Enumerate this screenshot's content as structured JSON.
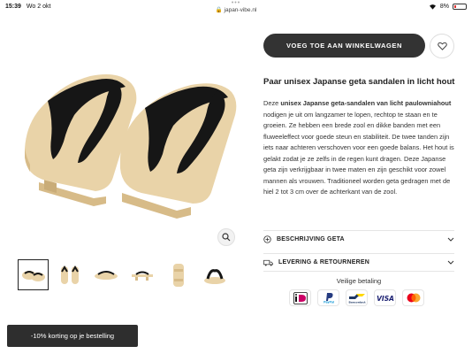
{
  "status_bar": {
    "time": "15:39",
    "date": "Wo 2 okt",
    "url": "japan-vibe.nl",
    "dots": "•••",
    "battery": "8%"
  },
  "product": {
    "add_to_cart_label": "VOEG TOE AAN WINKELWAGEN",
    "title": "Paar unisex Japanse geta sandalen in licht hout",
    "desc_prefix": "Deze ",
    "desc_bold": "unisex Japanse geta-sandalen van licht paulowniahout",
    "desc_rest": " nodigen je uit om langzamer te lopen, rechtop te staan en te groeien. Ze hebben een brede zool en dikke banden met een fluweeleffect voor goede steun en stabiliteit. De twee tanden zijn iets naar achteren verschoven voor een goede balans. Het hout is gelakt zodat je ze zelfs in de regen kunt dragen. Deze Japanse geta zijn verkrijgbaar in twee maten en zijn geschikt voor zowel mannen als vrouwen. Traditioneel worden geta gedragen met de hiel 2 tot 3 cm over de achterkant van de zool."
  },
  "accordions": [
    {
      "label": "BESCHRIJVING GETA",
      "icon": "plus-circle-icon"
    },
    {
      "label": "LEVERING & RETOURNEREN",
      "icon": "truck-icon"
    }
  ],
  "payment": {
    "title": "Veilige betaling",
    "methods": [
      "iDEAL",
      "PayPal",
      "Bancontact",
      "VISA",
      "Mastercard"
    ]
  },
  "promo": {
    "label": "-10% korting op je bestelling"
  },
  "colors": {
    "button_bg": "#333333",
    "wood": "#e9d3a8",
    "strap": "#161616"
  }
}
